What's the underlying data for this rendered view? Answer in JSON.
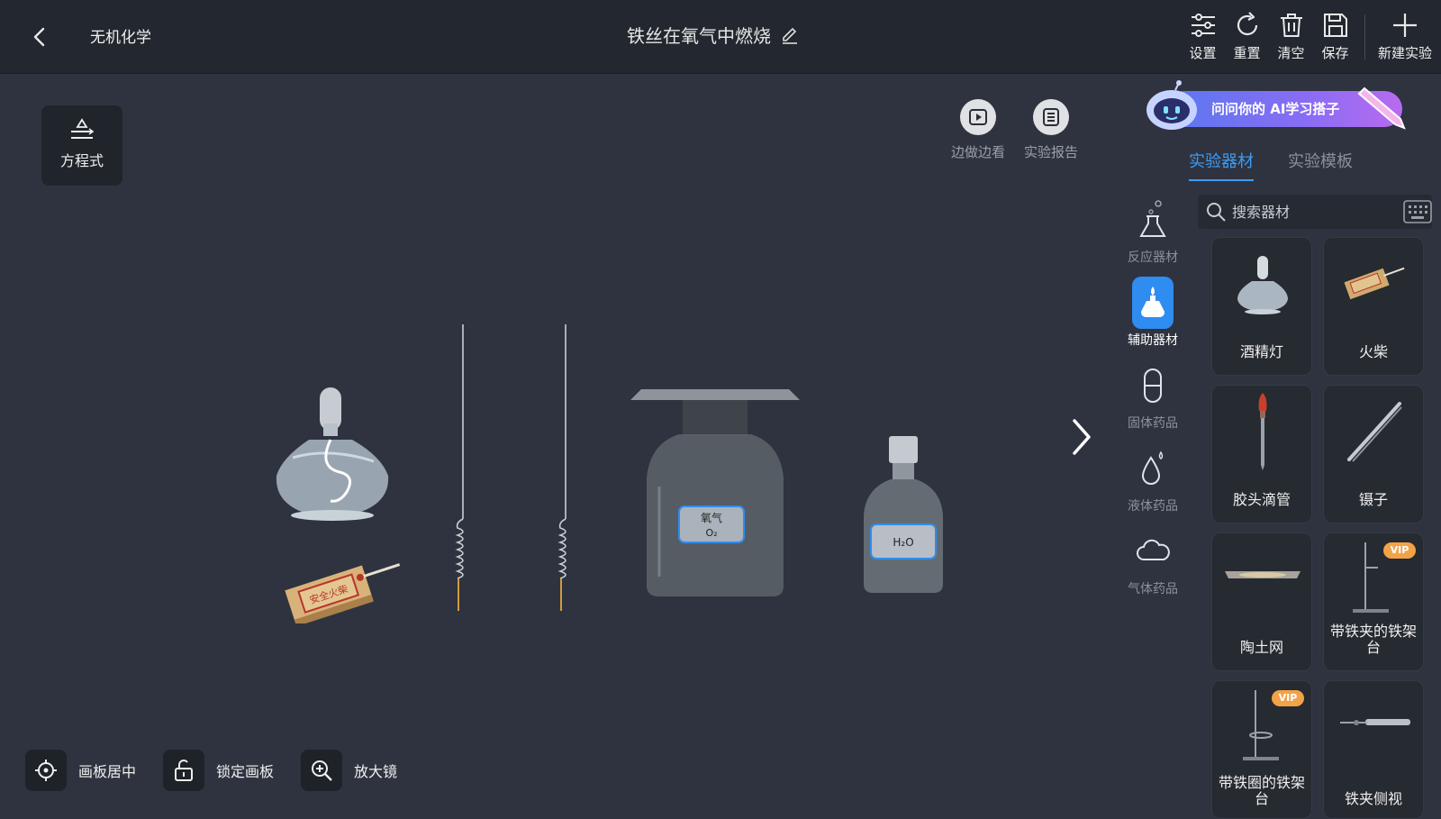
{
  "header": {
    "category": "无机化学",
    "title": "铁丝在氧气中燃烧",
    "tools": [
      {
        "label": "设置",
        "icon": "settings-sliders-icon"
      },
      {
        "label": "重置",
        "icon": "reset-icon"
      },
      {
        "label": "清空",
        "icon": "trash-icon"
      },
      {
        "label": "保存",
        "icon": "save-icon"
      },
      {
        "label": "新建实验",
        "icon": "plus-icon"
      }
    ]
  },
  "canvas": {
    "equation_label": "方程式",
    "media": [
      {
        "label": "边做边看",
        "icon": "play-icon"
      },
      {
        "label": "实验报告",
        "icon": "report-icon"
      }
    ],
    "bottom_controls": [
      {
        "label": "画板居中",
        "icon": "center-target-icon"
      },
      {
        "label": "锁定画板",
        "icon": "unlock-icon"
      },
      {
        "label": "放大镜",
        "icon": "magnifier-icon"
      }
    ],
    "board_items": {
      "oxygen_bottle_label": "氧气",
      "oxygen_formula": "O₂",
      "water_formula": "H₂O",
      "matchbox_text": "安全火柴"
    }
  },
  "panel": {
    "ai_banner": "问问你的 AI学习搭子",
    "tabs": [
      {
        "label": "实验器材",
        "active": true
      },
      {
        "label": "实验模板",
        "active": false
      }
    ],
    "categories": [
      {
        "label": "反应器材",
        "icon": "flask-icon",
        "active": false
      },
      {
        "label": "辅助器材",
        "icon": "alcohol-lamp-icon",
        "active": true
      },
      {
        "label": "固体药品",
        "icon": "capsule-icon",
        "active": false
      },
      {
        "label": "液体药品",
        "icon": "droplet-icon",
        "active": false
      },
      {
        "label": "气体药品",
        "icon": "cloud-icon",
        "active": false
      }
    ],
    "search_placeholder": "搜索器材",
    "items": [
      {
        "name": "酒精灯",
        "vip": false
      },
      {
        "name": "火柴",
        "vip": false
      },
      {
        "name": "胶头滴管",
        "vip": false
      },
      {
        "name": "镊子",
        "vip": false
      },
      {
        "name": "陶土网",
        "vip": false
      },
      {
        "name": "带铁夹的铁架台",
        "vip": true
      },
      {
        "name": "带铁圈的铁架台",
        "vip": true
      },
      {
        "name": "铁夹侧视",
        "vip": false
      }
    ],
    "vip_label": "VIP"
  },
  "colors": {
    "accent": "#3d9cf6",
    "topbar": "#23272f",
    "canvas": "#2e333f",
    "vip": "#f2a348"
  }
}
